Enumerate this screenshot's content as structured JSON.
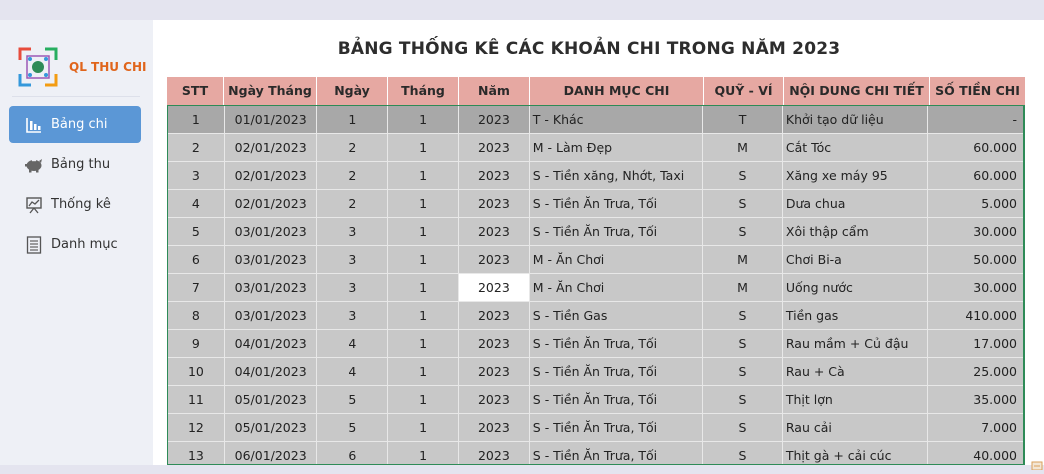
{
  "app": {
    "name": "QL THU CHI"
  },
  "sidebar": {
    "items": [
      {
        "label": "Bảng chi",
        "icon": "bar-chart-icon",
        "active": true
      },
      {
        "label": "Bảng thu",
        "icon": "piggy-bank-icon",
        "active": false
      },
      {
        "label": "Thống kê",
        "icon": "presentation-chart-icon",
        "active": false
      },
      {
        "label": "Danh mục",
        "icon": "list-document-icon",
        "active": false
      }
    ]
  },
  "main": {
    "title": "BẢNG THỐNG KÊ CÁC KHOẢN CHI TRONG NĂM 2023",
    "columns": [
      "STT",
      "Ngày Tháng",
      "Ngày",
      "Tháng",
      "Năm",
      "DANH MỤC CHI",
      "QUỸ - VÍ",
      "NỘI DUNG CHI TIẾT",
      "SỐ TIỀN CHI"
    ],
    "rows": [
      [
        "1",
        "01/01/2023",
        "1",
        "1",
        "2023",
        "T - Khác",
        "T",
        "Khởi tạo dữ liệu",
        "-"
      ],
      [
        "2",
        "02/01/2023",
        "2",
        "1",
        "2023",
        "M - Làm Đẹp",
        "M",
        "Cắt Tóc",
        "60.000"
      ],
      [
        "3",
        "02/01/2023",
        "2",
        "1",
        "2023",
        "S - Tiền xăng, Nhớt, Taxi",
        "S",
        "Xăng xe máy 95",
        "60.000"
      ],
      [
        "4",
        "02/01/2023",
        "2",
        "1",
        "2023",
        "S - Tiền Ăn Trưa, Tối",
        "S",
        "Dưa chua",
        "5.000"
      ],
      [
        "5",
        "03/01/2023",
        "3",
        "1",
        "2023",
        "S - Tiền Ăn Trưa, Tối",
        "S",
        "Xôi thập cẩm",
        "30.000"
      ],
      [
        "6",
        "03/01/2023",
        "3",
        "1",
        "2023",
        "M - Ăn Chơi",
        "M",
        "Chơi Bi-a",
        "50.000"
      ],
      [
        "7",
        "03/01/2023",
        "3",
        "1",
        "2023",
        "M - Ăn Chơi",
        "M",
        "Uống nước",
        "30.000"
      ],
      [
        "8",
        "03/01/2023",
        "3",
        "1",
        "2023",
        "S - Tiền Gas",
        "S",
        "Tiền gas",
        "410.000"
      ],
      [
        "9",
        "04/01/2023",
        "4",
        "1",
        "2023",
        "S - Tiền Ăn Trưa, Tối",
        "S",
        "Rau mầm + Củ đậu",
        "17.000"
      ],
      [
        "10",
        "04/01/2023",
        "4",
        "1",
        "2023",
        "S - Tiền Ăn Trưa, Tối",
        "S",
        "Rau + Cà",
        "25.000"
      ],
      [
        "11",
        "05/01/2023",
        "5",
        "1",
        "2023",
        "S - Tiền Ăn Trưa, Tối",
        "S",
        "Thịt lợn",
        "35.000"
      ],
      [
        "12",
        "05/01/2023",
        "5",
        "1",
        "2023",
        "S - Tiền Ăn Trưa, Tối",
        "S",
        "Rau cải",
        "7.000"
      ],
      [
        "13",
        "06/01/2023",
        "6",
        "1",
        "2023",
        "S - Tiền Ăn Trưa, Tối",
        "S",
        "Thịt gà + cải cúc",
        "40.000"
      ]
    ]
  },
  "colors": {
    "accent": "#5b97d6",
    "header_bg": "#e6a8a2",
    "row_bg": "#c8c8c8",
    "first_row_bg": "#a8a8a8",
    "app_name": "#e0651c",
    "table_border": "#2e8b57"
  }
}
